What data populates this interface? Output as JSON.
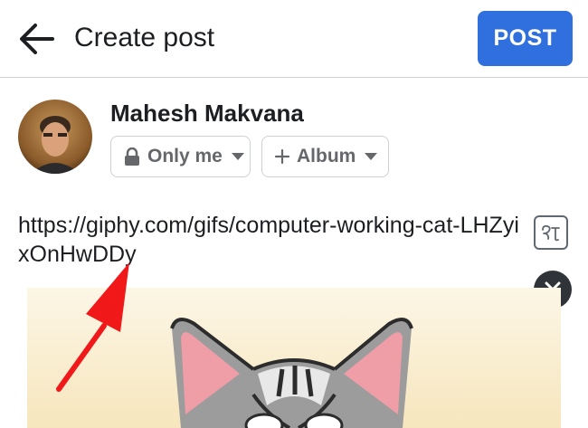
{
  "header": {
    "title": "Create post",
    "post_label": "POST",
    "back_icon": "arrow-left-icon"
  },
  "composer": {
    "user_name": "Mahesh Makvana",
    "privacy_label": "Only me",
    "album_label": "Album",
    "post_text": "https://giphy.com/gifs/computer-working-cat-LHZyixOnHwDDy"
  },
  "colors": {
    "accent": "#2f6fde",
    "annotation_arrow": "#f01818",
    "chip_text": "#65676b"
  }
}
